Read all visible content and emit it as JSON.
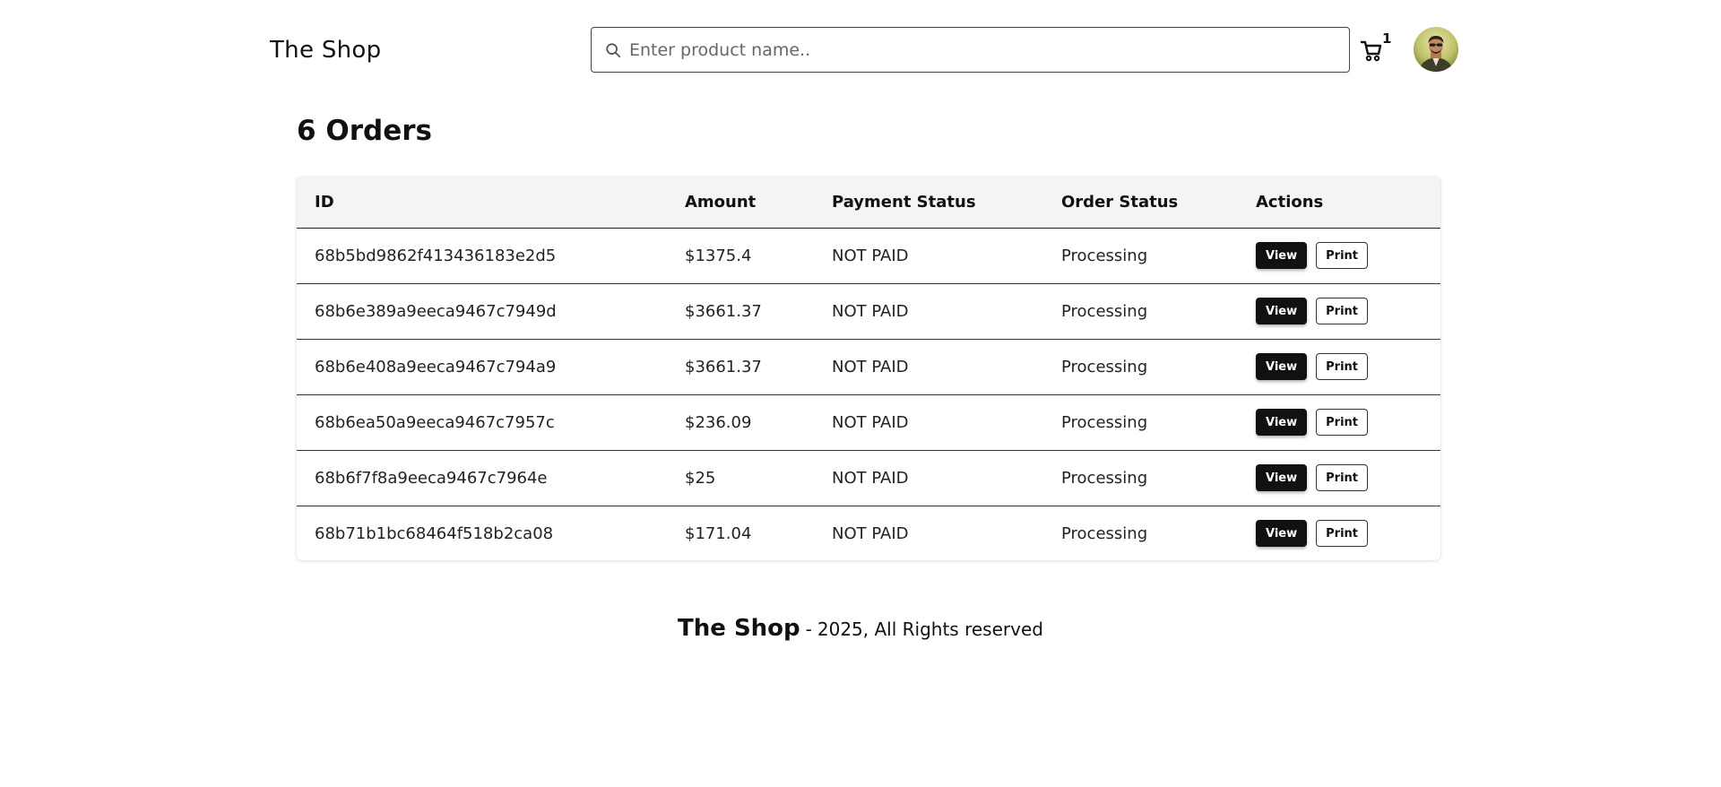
{
  "header": {
    "brand": "The Shop",
    "search": {
      "placeholder": "Enter product name..",
      "value": ""
    },
    "cart": {
      "icon": "cart-icon",
      "count": "1"
    },
    "avatar": {
      "icon": "user-avatar"
    }
  },
  "orders": {
    "title": "6 Orders",
    "columns": {
      "id": "ID",
      "amount": "Amount",
      "payment_status": "Payment Status",
      "order_status": "Order Status",
      "actions": "Actions"
    },
    "view_label": "View",
    "print_label": "Print",
    "rows": [
      {
        "id": "68b5bd9862f413436183e2d5",
        "amount": "$1375.4",
        "payment_status": "NOT PAID",
        "order_status": "Processing"
      },
      {
        "id": "68b6e389a9eeca9467c7949d",
        "amount": "$3661.37",
        "payment_status": "NOT PAID",
        "order_status": "Processing"
      },
      {
        "id": "68b6e408a9eeca9467c794a9",
        "amount": "$3661.37",
        "payment_status": "NOT PAID",
        "order_status": "Processing"
      },
      {
        "id": "68b6ea50a9eeca9467c7957c",
        "amount": "$236.09",
        "payment_status": "NOT PAID",
        "order_status": "Processing"
      },
      {
        "id": "68b6f7f8a9eeca9467c7964e",
        "amount": "$25",
        "payment_status": "NOT PAID",
        "order_status": "Processing"
      },
      {
        "id": "68b71b1bc68464f518b2ca08",
        "amount": "$171.04",
        "payment_status": "NOT PAID",
        "order_status": "Processing"
      }
    ]
  },
  "footer": {
    "brand": "The Shop",
    "separator": "-",
    "text": "2025, All Rights reserved"
  }
}
